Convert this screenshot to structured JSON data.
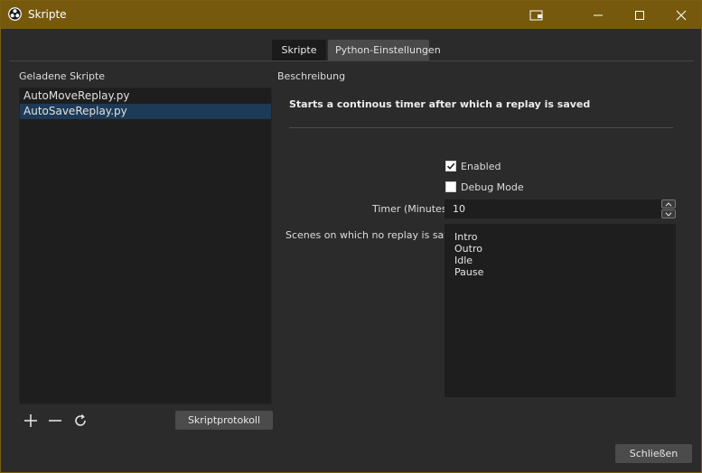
{
  "window": {
    "title": "Skripte"
  },
  "tabs": [
    {
      "label": "Skripte",
      "active": true
    },
    {
      "label": "Python-Einstellungen",
      "active": false
    }
  ],
  "loaded_scripts": {
    "heading": "Geladene Skripte",
    "items": [
      {
        "name": "AutoMoveReplay.py",
        "selected": false
      },
      {
        "name": "AutoSaveReplay.py",
        "selected": true
      }
    ],
    "log_button": "Skriptprotokoll"
  },
  "description": {
    "heading": "Beschreibung",
    "text": "Starts a continous timer after which a replay is saved"
  },
  "settings": {
    "enabled_label": "Enabled",
    "enabled_checked": true,
    "debug_label": "Debug Mode",
    "debug_checked": false,
    "timer_label": "Timer (Minutes)",
    "timer_value": "10",
    "scenes_label": "Scenes on which no replay is saved",
    "scenes": [
      "Intro",
      "Outro",
      "Idle",
      "Pause"
    ]
  },
  "footer": {
    "close_button": "Schließen"
  },
  "colors": {
    "titlebar": "#77590e",
    "selected_row": "#1d3a57",
    "background": "#2b2b2b"
  }
}
